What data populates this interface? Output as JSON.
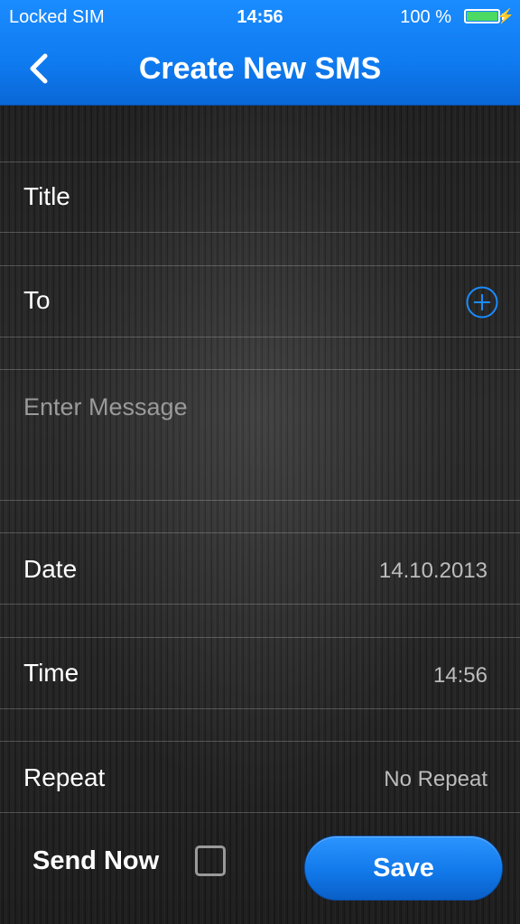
{
  "status_bar": {
    "carrier": "Locked SIM",
    "time": "14:56",
    "battery_percent": "100 %",
    "battery_level": 1.0,
    "battery_color": "#4cd964"
  },
  "nav": {
    "back_icon": "chevron-left-icon",
    "title": "Create New SMS",
    "accent_color": "#0f7bf0"
  },
  "form": {
    "title_label": "Title",
    "to_label": "To",
    "add_contact_icon": "plus-circle-icon",
    "message_placeholder": "Enter Message",
    "date_label": "Date",
    "date_value": "14.10.2013",
    "time_label": "Time",
    "time_value": "14:56",
    "repeat_label": "Repeat",
    "repeat_value": "No Repeat"
  },
  "footer": {
    "send_now_label": "Send Now",
    "send_now_checked": false,
    "save_label": "Save"
  }
}
